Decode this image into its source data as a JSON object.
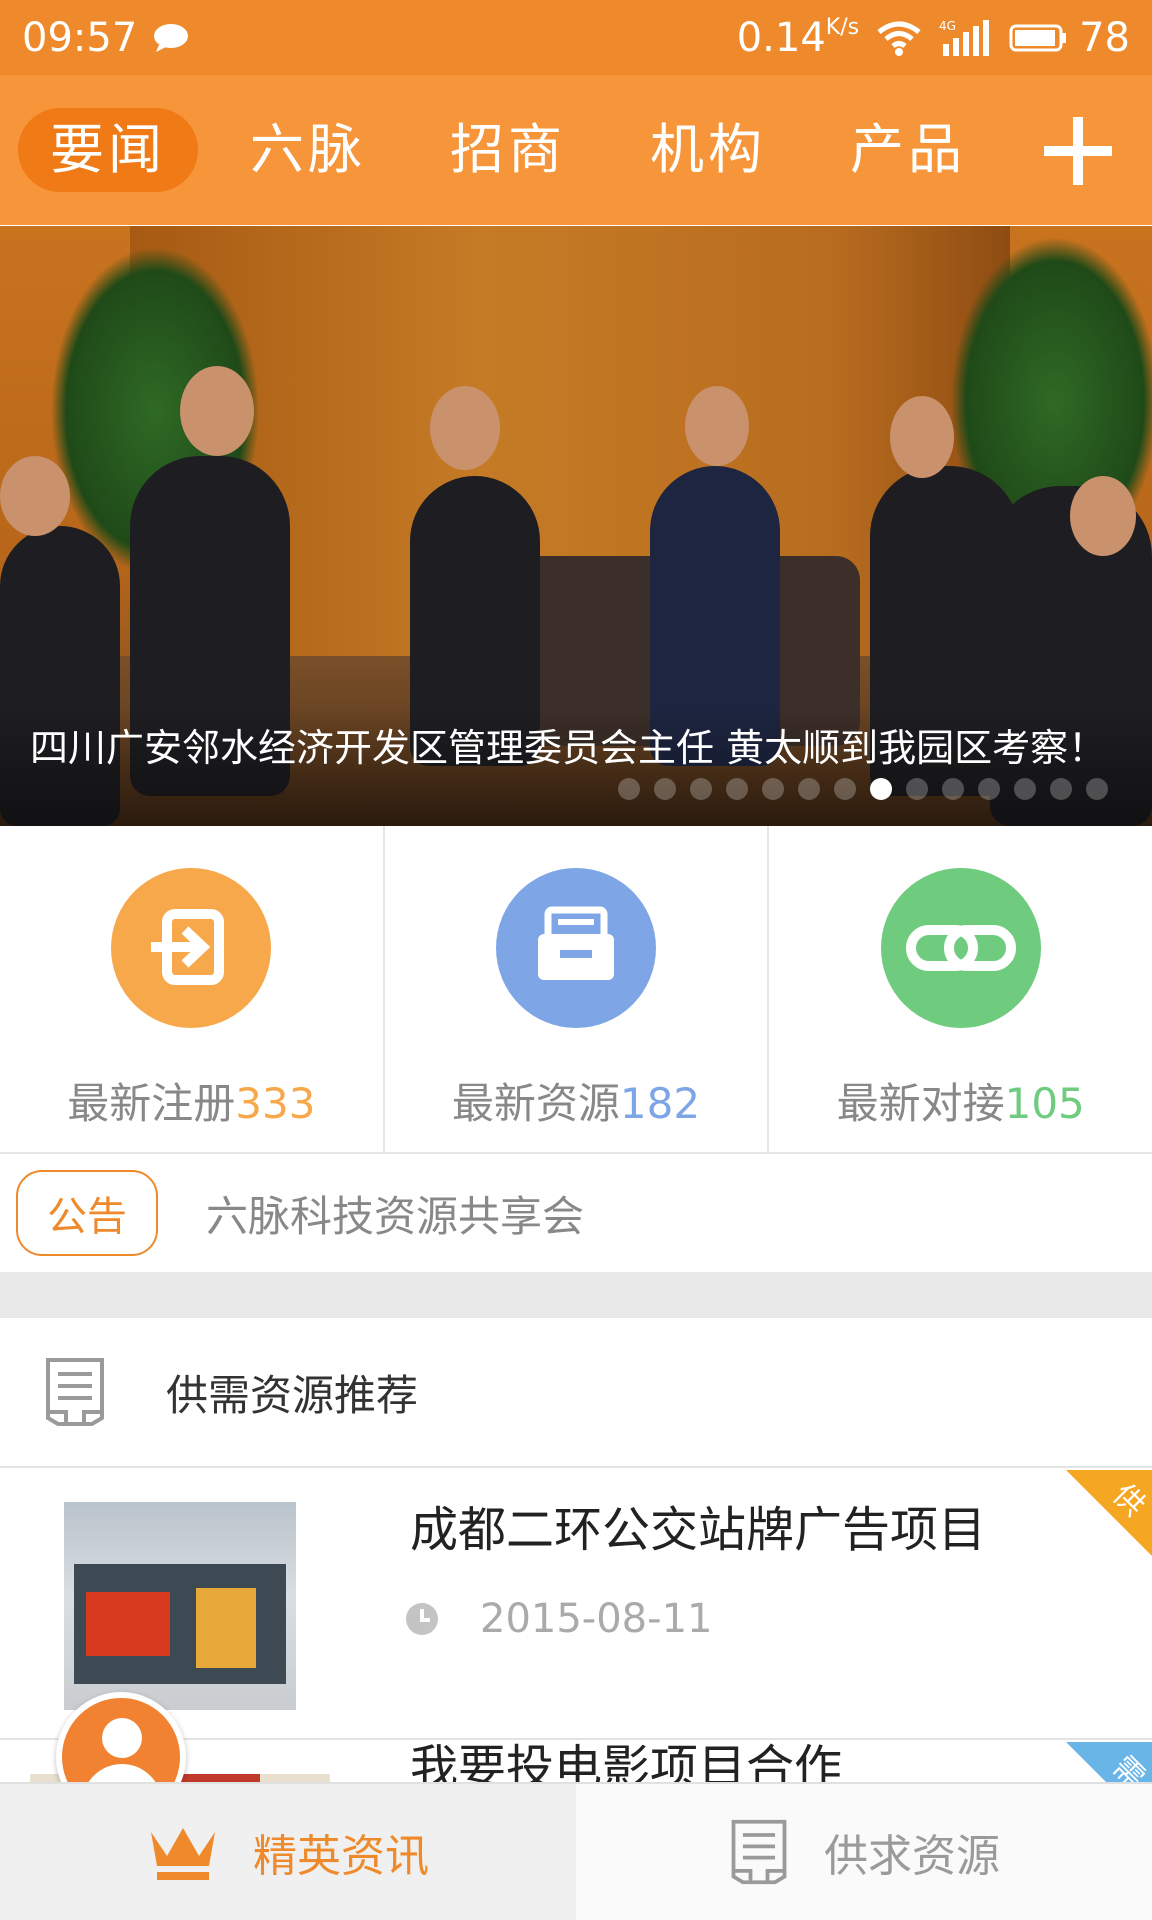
{
  "status_bar": {
    "time": "09:57",
    "speed": "0.14",
    "speed_unit": "K/s",
    "network": "4G",
    "battery": "78"
  },
  "top_nav": {
    "tabs": [
      {
        "label": "要闻",
        "active": true
      },
      {
        "label": "六脉",
        "active": false
      },
      {
        "label": "招商",
        "active": false
      },
      {
        "label": "机构",
        "active": false
      },
      {
        "label": "产品",
        "active": false
      }
    ]
  },
  "banner": {
    "caption": "四川广安邻水经济开发区管理委员会主任 黄太顺到我园区考察！",
    "slide_count": 14,
    "active_slide": 7
  },
  "stats": [
    {
      "label": "最新注册",
      "value": "333",
      "color": "#f7a84a",
      "icon": "login-icon"
    },
    {
      "label": "最新资源",
      "value": "182",
      "color": "#7ea6e6",
      "icon": "inbox-icon"
    },
    {
      "label": "最新对接",
      "value": "105",
      "color": "#6fcb7e",
      "icon": "link-icon"
    }
  ],
  "notice": {
    "badge": "公告",
    "text": "六脉科技资源共享会"
  },
  "section": {
    "title": "供需资源推荐"
  },
  "items": [
    {
      "title": "成都二环公交站牌广告项目",
      "date": "2015-08-11",
      "tag": "供",
      "tag_color": "#f5a623"
    },
    {
      "title": "我要投电影项目合作",
      "date": "",
      "tag": "需",
      "tag_color": "#6ab5e8"
    }
  ],
  "bottom_nav": {
    "tabs": [
      {
        "label": "精英资讯",
        "active": true,
        "icon": "crown-icon"
      },
      {
        "label": "供求资源",
        "active": false,
        "icon": "document-icon"
      }
    ]
  },
  "colors": {
    "accent": "#ef8a2c",
    "nav_bg": "#f7953a"
  }
}
